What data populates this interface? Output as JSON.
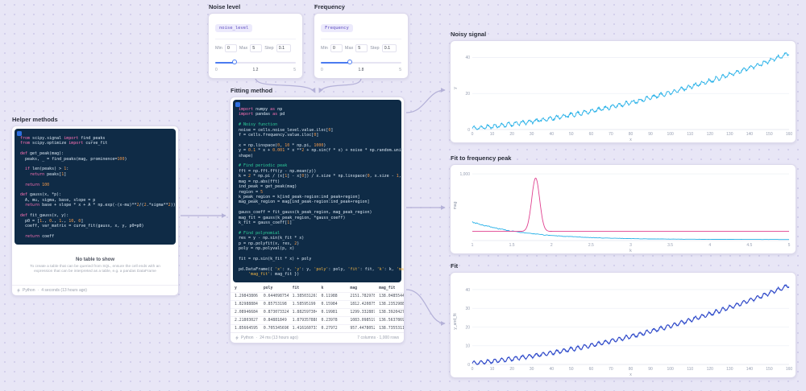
{
  "cells": {
    "noise": {
      "title": "Noise level",
      "pill": "noise_level",
      "fields": {
        "min_label": "Min",
        "min": "0",
        "max_label": "Max",
        "max": "5",
        "step_label": "Step",
        "step": "0.1"
      },
      "slider": {
        "min": "0",
        "value": "1.2",
        "max": "5",
        "fraction": 0.24
      }
    },
    "freq": {
      "title": "Frequency",
      "pill": "Frequency",
      "fields": {
        "min_label": "Min",
        "min": "0",
        "max_label": "Max",
        "max": "5",
        "step_label": "Step",
        "step": "0.1"
      },
      "slider": {
        "min": "0",
        "value": "1.8",
        "max": "5",
        "fraction": 0.36
      }
    },
    "helper": {
      "title": "Helper methods",
      "code": [
        "from scipy.signal import find_peaks",
        "from scipy.optimize import curve_fit",
        "",
        "def get_peak(mag):",
        "  peaks, _ = find_peaks(mag, prominence=100)",
        "",
        "  if len(peaks) > 1:",
        "    return peaks[1]",
        "",
        "  return 100",
        "",
        "def gauss(x, *p):",
        "  A, mu, sigma, base, slope = p",
        "  return base + slope * x + A * np.exp(-(x-mu)**2/(2.*sigma**2))",
        "",
        "def fit_gauss(x, y):",
        "  p0 = [1., 0., 1., 10, 0]",
        "  coeff, var_matrix = curve_fit(gauss, x, y, p0=p0)",
        "",
        "  return coeff"
      ],
      "empty": {
        "title": "No table to show",
        "body": "To create a table that can be queried from SQL, ensure the cell ends with an expression that can be interpreted as a table, e.g. a pandas DataFrame"
      },
      "footer": {
        "lang": "Python",
        "sep": "·",
        "runtime": "4 seconds (13 hours ago)",
        "info": ""
      }
    },
    "fitting": {
      "title": "Fitting method",
      "code": [
        "import numpy as np",
        "import pandas as pd",
        "",
        "# Noisy function",
        "noise = cells.noise_level.value.iloc[0]",
        "f = cells.frequency.value.iloc[0]",
        "",
        "x = np.linspace(0, 10 * np.pi, 1000)",
        "y = 0.1 * x + 0.001 * x **2 + np.sin(f * x) + noise * np.random.uniform(size=x.",
        "shape)",
        "",
        "# Find periodic peak",
        "fft = np.fft.fft(y - np.mean(y))",
        "k = 2 * np.pi / (x[1] - x[0]) / x.size * np.linspace(0, x.size - 1, x.size)",
        "mag = np.abs(fft)",
        "ind_peak = get_peak(mag)",
        "region = 5",
        "k_peak_region = k[ind_peak-region:ind_peak+region]",
        "mag_peak_region = mag[ind_peak-region:ind_peak+region]",
        "",
        "gauss_coeff = fit_gauss(k_peak_region, mag_peak_region)",
        "mag_fit = gauss(k_peak_region, *gauss_coeff)",
        "k_fit = gauss_coeff[1]",
        "",
        "# Find polynomial",
        "res = y - np.sin(k_fit * x)",
        "p = np.polyfit(x, res, 2)",
        "poly = np.polyval(p, x)",
        "",
        "fit = np.sin(k_fit * x) + poly",
        "",
        "pd.DataFrame({ 'x': x, 'y': y, 'poly': poly, 'fit': fit, 'k': k, 'mag': mag,",
        "    'mag_fit': mag_fit })"
      ],
      "table": {
        "columns": [
          "y",
          "poly",
          "fit",
          "k",
          "mag",
          "mag_fit"
        ],
        "rows": [
          [
            "1.29843806",
            "0.644098754",
            "1.385031261",
            "0.11988",
            "2151.78297872",
            "138.048554429"
          ],
          [
            "1.82988884",
            "0.85753198",
            "1.58595199",
            "0.15984",
            "1812.42087518",
            "138.235298815"
          ],
          [
            "2.08946684",
            "0.873073324",
            "1.882597304",
            "0.19981",
            "1299.33288761",
            "138.392042798"
          ],
          [
            "2.21803027",
            "0.84881849",
            "1.879357888",
            "0.23978",
            "1083.09851967",
            "136.563786983"
          ],
          [
            "1.85664595",
            "0.705345696",
            "1.416160733",
            "0.27972",
            "957.447805231",
            "138.735531187"
          ]
        ]
      },
      "footer": {
        "lang": "Python",
        "sep": "·",
        "runtime": "24 ms (13 hours ago)",
        "info": "7 columns · 1,000 rows"
      }
    }
  },
  "chart_data": [
    {
      "id": "noisy_signal",
      "title": "Noisy signal",
      "type": "line",
      "xlabel": "x",
      "ylabel": "y",
      "xlim": [
        0,
        160
      ],
      "ylim": [
        0,
        46
      ],
      "xticks": [
        0,
        10,
        20,
        30,
        40,
        50,
        60,
        70,
        80,
        90,
        100,
        110,
        120,
        130,
        140,
        150,
        160
      ],
      "yticks": [
        0,
        20,
        40
      ],
      "grid": true,
      "legend": "none",
      "series": [
        {
          "name": "y",
          "color": "#28b1e8",
          "kind": "noisy_trend",
          "n": 700,
          "seed": 11,
          "a1": 0.1,
          "a2": 0.001,
          "amp": 1.0,
          "freq": 1.8,
          "noise": 1.2
        }
      ]
    },
    {
      "id": "freq_peak",
      "title": "Fit to frequency peak",
      "type": "line",
      "xlabel": "k",
      "ylabel": "mag",
      "xlim": [
        1,
        5
      ],
      "ylim": [
        0,
        1050
      ],
      "xticks": [
        1,
        1.5,
        2,
        2.5,
        3,
        3.5,
        4,
        4.5,
        5
      ],
      "yticks": [
        1000
      ],
      "grid": true,
      "legend": "none",
      "series": [
        {
          "name": "mag",
          "color": "#28b1e8",
          "kind": "decay",
          "n": 280,
          "seed": 3,
          "base": 15,
          "A": 255,
          "lam": 1.5,
          "noise": 22
        },
        {
          "name": "mag_fit",
          "color": "#e0408f",
          "kind": "gauss",
          "n": 420,
          "base": 138,
          "A": 800,
          "mu": 1.8,
          "sigma": 0.05
        }
      ]
    },
    {
      "id": "fit",
      "title": "Fit",
      "type": "line",
      "xlabel": "x",
      "ylabel": "y_and_fit",
      "xlim": [
        0,
        160
      ],
      "ylim": [
        0,
        46
      ],
      "xticks": [
        0,
        10,
        20,
        30,
        40,
        50,
        60,
        70,
        80,
        90,
        100,
        110,
        120,
        130,
        140,
        150,
        160
      ],
      "yticks": [
        0,
        10,
        20,
        30,
        40
      ],
      "grid": true,
      "legend": "none",
      "series": [
        {
          "name": "y",
          "color": "#5b82e6",
          "kind": "noisy_trend",
          "n": 700,
          "seed": 11,
          "a1": 0.1,
          "a2": 0.001,
          "amp": 1.0,
          "freq": 1.8,
          "noise": 1.2
        },
        {
          "name": "fit",
          "color": "#2a3cbf",
          "kind": "noisy_trend",
          "n": 700,
          "seed": 1,
          "a1": 0.1,
          "a2": 0.001,
          "amp": 1.0,
          "freq": 1.8,
          "noise": 0,
          "offset": 0.6
        }
      ]
    }
  ]
}
